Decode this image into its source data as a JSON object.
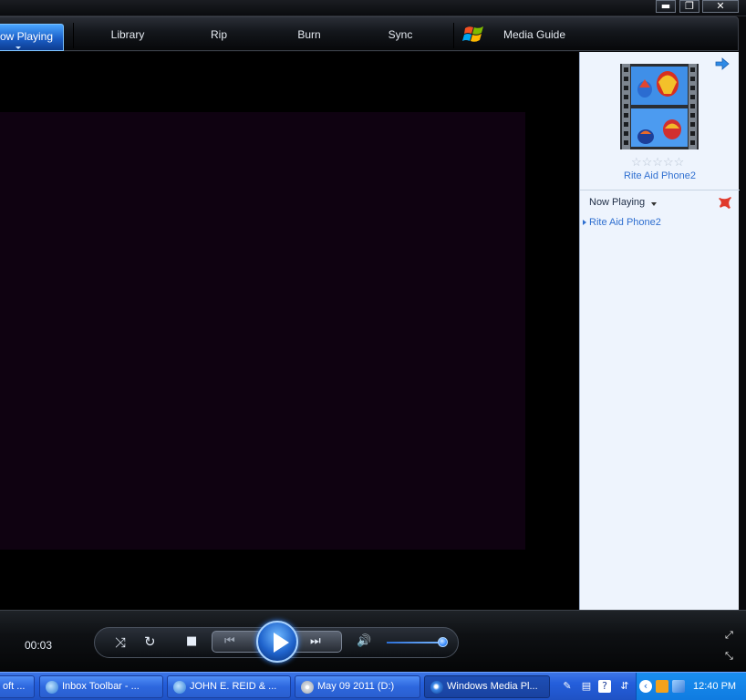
{
  "window": {
    "minimize_glyph": "▬",
    "restore_glyph": "❐",
    "close_glyph": "✕"
  },
  "tabs": [
    {
      "label": "ow Playing",
      "active": true
    },
    {
      "label": "Library"
    },
    {
      "label": "Rip"
    },
    {
      "label": "Burn"
    },
    {
      "label": "Sync"
    },
    {
      "label": "Media Guide"
    }
  ],
  "panel": {
    "album_title": "Rite Aid Phone2",
    "stars": "☆☆☆☆☆",
    "now_playing_label": "Now Playing",
    "playlist": [
      {
        "title": "Rite Aid Phone2"
      }
    ]
  },
  "controls": {
    "elapsed": "00:03",
    "shuffle_glyph": "⤨",
    "repeat_glyph": "↻",
    "stop_glyph": "■",
    "prev_glyph": "⏮",
    "next_glyph": "⏭",
    "mute_glyph": "🔊",
    "volume_level": 0.9,
    "fullscreen_glyph": "⤢",
    "compact_glyph": "⤡"
  },
  "taskbar": {
    "items": [
      {
        "label": "oft ...",
        "icon": "app-icon"
      },
      {
        "label": "Inbox Toolbar - ...",
        "icon": "ie-icon"
      },
      {
        "label": "JOHN E. REID & ...",
        "icon": "ie-icon"
      },
      {
        "label": "May 09 2011 (D:)",
        "icon": "cd-icon"
      },
      {
        "label": "Windows Media Pl...",
        "icon": "wmp-icon",
        "active": true
      }
    ],
    "clock": "12:40 PM"
  },
  "colors": {
    "accent": "#2f6fd0",
    "video_bg": "#0f0211",
    "taskbar": "#245edb",
    "tray": "#1a8ef0"
  }
}
